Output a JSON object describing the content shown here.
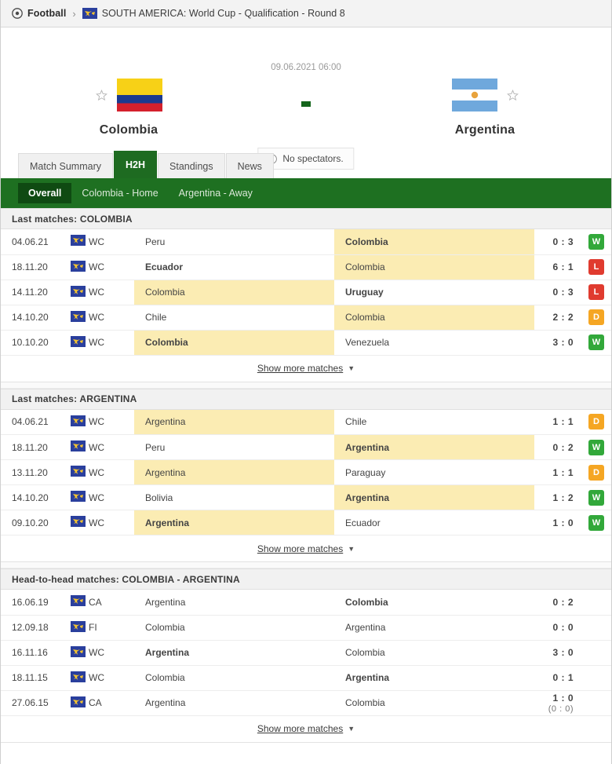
{
  "breadcrumb": {
    "sport": "Football",
    "separator": "›",
    "sport_icon": "football-icon",
    "tournament_icon": "conmebol-flag-icon",
    "tournament": "SOUTH AMERICA: World Cup - Qualification - Round 8"
  },
  "match": {
    "kickoff": "09.06.2021 06:00",
    "score_placeholder": "-",
    "home_team": "Colombia",
    "away_team": "Argentina",
    "home_flag_icon": "colombia-flag-icon",
    "away_flag_icon": "argentina-flag-icon",
    "home_star_icon": "star-outline-icon",
    "away_star_icon": "star-outline-icon",
    "spectators_note": "No spectators.",
    "spectators_icon": "info-circle-icon"
  },
  "tabs": [
    {
      "label": "Match Summary",
      "active": false
    },
    {
      "label": "H2H",
      "active": true
    },
    {
      "label": "Standings",
      "active": false
    },
    {
      "label": "News",
      "active": false
    }
  ],
  "subtabs": [
    {
      "label": "Overall",
      "active": true
    },
    {
      "label": "Colombia - Home",
      "active": false
    },
    {
      "label": "Argentina - Away",
      "active": false
    }
  ],
  "show_more_label": "Show more matches",
  "show_more_caret": "▼",
  "colors": {
    "accent_green": "#1e7021",
    "active_subtab": "#0f4a12",
    "win": "#32a83a",
    "loss": "#e03b2f",
    "draw": "#f5a623",
    "highlight": "#fbecb3"
  },
  "sections": [
    {
      "title": "Last matches: COLOMBIA",
      "has_result_badge": true,
      "rows": [
        {
          "date": "04.06.21",
          "comp": "WC",
          "badge_icon": "conmebol-flag-icon",
          "home": "Peru",
          "away": "Colombia",
          "home_bold": false,
          "away_bold": true,
          "home_hl": false,
          "away_hl": true,
          "score": "0 : 3",
          "sub_score": "",
          "result": "W"
        },
        {
          "date": "18.11.20",
          "comp": "WC",
          "badge_icon": "conmebol-flag-icon",
          "home": "Ecuador",
          "away": "Colombia",
          "home_bold": true,
          "away_bold": false,
          "home_hl": false,
          "away_hl": true,
          "score": "6 : 1",
          "sub_score": "",
          "result": "L"
        },
        {
          "date": "14.11.20",
          "comp": "WC",
          "badge_icon": "conmebol-flag-icon",
          "home": "Colombia",
          "away": "Uruguay",
          "home_bold": false,
          "away_bold": true,
          "home_hl": true,
          "away_hl": false,
          "score": "0 : 3",
          "sub_score": "",
          "result": "L"
        },
        {
          "date": "14.10.20",
          "comp": "WC",
          "badge_icon": "conmebol-flag-icon",
          "home": "Chile",
          "away": "Colombia",
          "home_bold": false,
          "away_bold": false,
          "home_hl": false,
          "away_hl": true,
          "score": "2 : 2",
          "sub_score": "",
          "result": "D"
        },
        {
          "date": "10.10.20",
          "comp": "WC",
          "badge_icon": "conmebol-flag-icon",
          "home": "Colombia",
          "away": "Venezuela",
          "home_bold": true,
          "away_bold": false,
          "home_hl": true,
          "away_hl": false,
          "score": "3 : 0",
          "sub_score": "",
          "result": "W"
        }
      ]
    },
    {
      "title": "Last matches: ARGENTINA",
      "has_result_badge": true,
      "rows": [
        {
          "date": "04.06.21",
          "comp": "WC",
          "badge_icon": "conmebol-flag-icon",
          "home": "Argentina",
          "away": "Chile",
          "home_bold": false,
          "away_bold": false,
          "home_hl": true,
          "away_hl": false,
          "score": "1 : 1",
          "sub_score": "",
          "result": "D"
        },
        {
          "date": "18.11.20",
          "comp": "WC",
          "badge_icon": "conmebol-flag-icon",
          "home": "Peru",
          "away": "Argentina",
          "home_bold": false,
          "away_bold": true,
          "home_hl": false,
          "away_hl": true,
          "score": "0 : 2",
          "sub_score": "",
          "result": "W"
        },
        {
          "date": "13.11.20",
          "comp": "WC",
          "badge_icon": "conmebol-flag-icon",
          "home": "Argentina",
          "away": "Paraguay",
          "home_bold": false,
          "away_bold": false,
          "home_hl": true,
          "away_hl": false,
          "score": "1 : 1",
          "sub_score": "",
          "result": "D"
        },
        {
          "date": "14.10.20",
          "comp": "WC",
          "badge_icon": "conmebol-flag-icon",
          "home": "Bolivia",
          "away": "Argentina",
          "home_bold": false,
          "away_bold": true,
          "home_hl": false,
          "away_hl": true,
          "score": "1 : 2",
          "sub_score": "",
          "result": "W"
        },
        {
          "date": "09.10.20",
          "comp": "WC",
          "badge_icon": "conmebol-flag-icon",
          "home": "Argentina",
          "away": "Ecuador",
          "home_bold": true,
          "away_bold": false,
          "home_hl": true,
          "away_hl": false,
          "score": "1 : 0",
          "sub_score": "",
          "result": "W"
        }
      ]
    },
    {
      "title": "Head-to-head matches: COLOMBIA - ARGENTINA",
      "has_result_badge": false,
      "rows": [
        {
          "date": "16.06.19",
          "comp": "CA",
          "badge_icon": "conmebol-flag-icon",
          "home": "Argentina",
          "away": "Colombia",
          "home_bold": false,
          "away_bold": true,
          "home_hl": false,
          "away_hl": false,
          "score": "0 : 2",
          "sub_score": "",
          "result": ""
        },
        {
          "date": "12.09.18",
          "comp": "FI",
          "badge_icon": "conmebol-flag-icon",
          "home": "Colombia",
          "away": "Argentina",
          "home_bold": false,
          "away_bold": false,
          "home_hl": false,
          "away_hl": false,
          "score": "0 : 0",
          "sub_score": "",
          "result": ""
        },
        {
          "date": "16.11.16",
          "comp": "WC",
          "badge_icon": "conmebol-flag-icon",
          "home": "Argentina",
          "away": "Colombia",
          "home_bold": true,
          "away_bold": false,
          "home_hl": false,
          "away_hl": false,
          "score": "3 : 0",
          "sub_score": "",
          "result": ""
        },
        {
          "date": "18.11.15",
          "comp": "WC",
          "badge_icon": "conmebol-flag-icon",
          "home": "Colombia",
          "away": "Argentina",
          "home_bold": false,
          "away_bold": true,
          "home_hl": false,
          "away_hl": false,
          "score": "0 : 1",
          "sub_score": "",
          "result": ""
        },
        {
          "date": "27.06.15",
          "comp": "CA",
          "badge_icon": "conmebol-flag-icon",
          "home": "Argentina",
          "away": "Colombia",
          "home_bold": false,
          "away_bold": false,
          "home_hl": false,
          "away_hl": false,
          "score": "1 : 0",
          "sub_score": "(0 : 0)",
          "result": ""
        }
      ]
    }
  ]
}
